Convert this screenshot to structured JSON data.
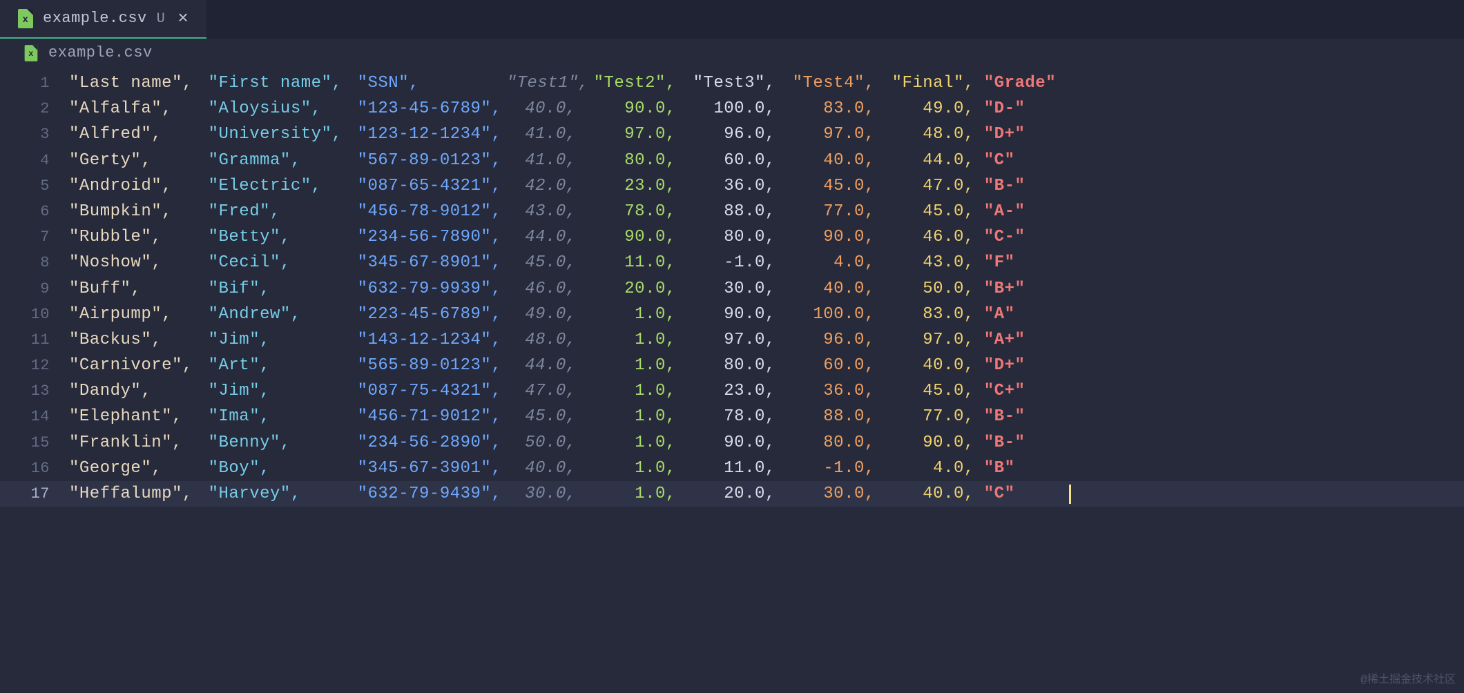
{
  "tab": {
    "filename": "example.csv",
    "modified_indicator": "U",
    "close_glyph": "×"
  },
  "breadcrumb": {
    "filename": "example.csv"
  },
  "watermark": "@稀土掘金技术社区",
  "col_widths_ch": [
    14,
    15,
    15,
    8,
    10,
    10,
    10,
    10,
    9
  ],
  "right_align_cols": [
    3,
    4,
    5,
    6,
    7
  ],
  "rows": [
    {
      "n": 1,
      "cursor": false,
      "cells": [
        {
          "txt": "\"Last name\",",
          "cls": "t-tan"
        },
        {
          "txt": "\"First name\",",
          "cls": "t-cyan"
        },
        {
          "txt": "\"SSN\",",
          "cls": "t-blue"
        },
        {
          "txt": "\"Test1\",",
          "cls": "t-dim"
        },
        {
          "txt": "\"Test2\",",
          "cls": "t-green"
        },
        {
          "txt": "\"Test3\",",
          "cls": "t-white"
        },
        {
          "txt": "\"Test4\",",
          "cls": "t-orange"
        },
        {
          "txt": "\"Final\",",
          "cls": "t-yellow"
        },
        {
          "txt": "\"Grade\"",
          "cls": "t-red"
        }
      ]
    },
    {
      "n": 2,
      "cursor": false,
      "cells": [
        {
          "txt": "\"Alfalfa\",",
          "cls": "t-tan"
        },
        {
          "txt": "\"Aloysius\",",
          "cls": "t-cyan"
        },
        {
          "txt": "\"123-45-6789\",",
          "cls": "t-blue"
        },
        {
          "txt": "40.0,",
          "cls": "t-dim"
        },
        {
          "txt": "90.0,",
          "cls": "t-green"
        },
        {
          "txt": "100.0,",
          "cls": "t-white"
        },
        {
          "txt": "83.0,",
          "cls": "t-orange"
        },
        {
          "txt": "49.0,",
          "cls": "t-yellow"
        },
        {
          "txt": "\"D-\"",
          "cls": "t-red"
        }
      ]
    },
    {
      "n": 3,
      "cursor": false,
      "cells": [
        {
          "txt": "\"Alfred\",",
          "cls": "t-tan"
        },
        {
          "txt": "\"University\",",
          "cls": "t-cyan"
        },
        {
          "txt": "\"123-12-1234\",",
          "cls": "t-blue"
        },
        {
          "txt": "41.0,",
          "cls": "t-dim"
        },
        {
          "txt": "97.0,",
          "cls": "t-green"
        },
        {
          "txt": "96.0,",
          "cls": "t-white"
        },
        {
          "txt": "97.0,",
          "cls": "t-orange"
        },
        {
          "txt": "48.0,",
          "cls": "t-yellow"
        },
        {
          "txt": "\"D+\"",
          "cls": "t-red"
        }
      ]
    },
    {
      "n": 4,
      "cursor": false,
      "cells": [
        {
          "txt": "\"Gerty\",",
          "cls": "t-tan"
        },
        {
          "txt": "\"Gramma\",",
          "cls": "t-cyan"
        },
        {
          "txt": "\"567-89-0123\",",
          "cls": "t-blue"
        },
        {
          "txt": "41.0,",
          "cls": "t-dim"
        },
        {
          "txt": "80.0,",
          "cls": "t-green"
        },
        {
          "txt": "60.0,",
          "cls": "t-white"
        },
        {
          "txt": "40.0,",
          "cls": "t-orange"
        },
        {
          "txt": "44.0,",
          "cls": "t-yellow"
        },
        {
          "txt": "\"C\"",
          "cls": "t-red"
        }
      ]
    },
    {
      "n": 5,
      "cursor": false,
      "cells": [
        {
          "txt": "\"Android\",",
          "cls": "t-tan"
        },
        {
          "txt": "\"Electric\",",
          "cls": "t-cyan"
        },
        {
          "txt": "\"087-65-4321\",",
          "cls": "t-blue"
        },
        {
          "txt": "42.0,",
          "cls": "t-dim"
        },
        {
          "txt": "23.0,",
          "cls": "t-green"
        },
        {
          "txt": "36.0,",
          "cls": "t-white"
        },
        {
          "txt": "45.0,",
          "cls": "t-orange"
        },
        {
          "txt": "47.0,",
          "cls": "t-yellow"
        },
        {
          "txt": "\"B-\"",
          "cls": "t-red"
        }
      ]
    },
    {
      "n": 6,
      "cursor": false,
      "cells": [
        {
          "txt": "\"Bumpkin\",",
          "cls": "t-tan"
        },
        {
          "txt": "\"Fred\",",
          "cls": "t-cyan"
        },
        {
          "txt": "\"456-78-9012\",",
          "cls": "t-blue"
        },
        {
          "txt": "43.0,",
          "cls": "t-dim"
        },
        {
          "txt": "78.0,",
          "cls": "t-green"
        },
        {
          "txt": "88.0,",
          "cls": "t-white"
        },
        {
          "txt": "77.0,",
          "cls": "t-orange"
        },
        {
          "txt": "45.0,",
          "cls": "t-yellow"
        },
        {
          "txt": "\"A-\"",
          "cls": "t-red"
        }
      ]
    },
    {
      "n": 7,
      "cursor": false,
      "cells": [
        {
          "txt": "\"Rubble\",",
          "cls": "t-tan"
        },
        {
          "txt": "\"Betty\",",
          "cls": "t-cyan"
        },
        {
          "txt": "\"234-56-7890\",",
          "cls": "t-blue"
        },
        {
          "txt": "44.0,",
          "cls": "t-dim"
        },
        {
          "txt": "90.0,",
          "cls": "t-green"
        },
        {
          "txt": "80.0,",
          "cls": "t-white"
        },
        {
          "txt": "90.0,",
          "cls": "t-orange"
        },
        {
          "txt": "46.0,",
          "cls": "t-yellow"
        },
        {
          "txt": "\"C-\"",
          "cls": "t-red"
        }
      ]
    },
    {
      "n": 8,
      "cursor": false,
      "cells": [
        {
          "txt": "\"Noshow\",",
          "cls": "t-tan"
        },
        {
          "txt": "\"Cecil\",",
          "cls": "t-cyan"
        },
        {
          "txt": "\"345-67-8901\",",
          "cls": "t-blue"
        },
        {
          "txt": "45.0,",
          "cls": "t-dim"
        },
        {
          "txt": "11.0,",
          "cls": "t-green"
        },
        {
          "txt": "-1.0,",
          "cls": "t-white"
        },
        {
          "txt": "4.0,",
          "cls": "t-orange"
        },
        {
          "txt": "43.0,",
          "cls": "t-yellow"
        },
        {
          "txt": "\"F\"",
          "cls": "t-red"
        }
      ]
    },
    {
      "n": 9,
      "cursor": false,
      "cells": [
        {
          "txt": "\"Buff\",",
          "cls": "t-tan"
        },
        {
          "txt": "\"Bif\",",
          "cls": "t-cyan"
        },
        {
          "txt": "\"632-79-9939\",",
          "cls": "t-blue"
        },
        {
          "txt": "46.0,",
          "cls": "t-dim"
        },
        {
          "txt": "20.0,",
          "cls": "t-green"
        },
        {
          "txt": "30.0,",
          "cls": "t-white"
        },
        {
          "txt": "40.0,",
          "cls": "t-orange"
        },
        {
          "txt": "50.0,",
          "cls": "t-yellow"
        },
        {
          "txt": "\"B+\"",
          "cls": "t-red"
        }
      ]
    },
    {
      "n": 10,
      "cursor": false,
      "cells": [
        {
          "txt": "\"Airpump\",",
          "cls": "t-tan"
        },
        {
          "txt": "\"Andrew\",",
          "cls": "t-cyan"
        },
        {
          "txt": "\"223-45-6789\",",
          "cls": "t-blue"
        },
        {
          "txt": "49.0,",
          "cls": "t-dim"
        },
        {
          "txt": "1.0,",
          "cls": "t-green"
        },
        {
          "txt": "90.0,",
          "cls": "t-white"
        },
        {
          "txt": "100.0,",
          "cls": "t-orange"
        },
        {
          "txt": "83.0,",
          "cls": "t-yellow"
        },
        {
          "txt": "\"A\"",
          "cls": "t-red"
        }
      ]
    },
    {
      "n": 11,
      "cursor": false,
      "cells": [
        {
          "txt": "\"Backus\",",
          "cls": "t-tan"
        },
        {
          "txt": "\"Jim\",",
          "cls": "t-cyan"
        },
        {
          "txt": "\"143-12-1234\",",
          "cls": "t-blue"
        },
        {
          "txt": "48.0,",
          "cls": "t-dim"
        },
        {
          "txt": "1.0,",
          "cls": "t-green"
        },
        {
          "txt": "97.0,",
          "cls": "t-white"
        },
        {
          "txt": "96.0,",
          "cls": "t-orange"
        },
        {
          "txt": "97.0,",
          "cls": "t-yellow"
        },
        {
          "txt": "\"A+\"",
          "cls": "t-red"
        }
      ]
    },
    {
      "n": 12,
      "cursor": false,
      "cells": [
        {
          "txt": "\"Carnivore\",",
          "cls": "t-tan"
        },
        {
          "txt": "\"Art\",",
          "cls": "t-cyan"
        },
        {
          "txt": "\"565-89-0123\",",
          "cls": "t-blue"
        },
        {
          "txt": "44.0,",
          "cls": "t-dim"
        },
        {
          "txt": "1.0,",
          "cls": "t-green"
        },
        {
          "txt": "80.0,",
          "cls": "t-white"
        },
        {
          "txt": "60.0,",
          "cls": "t-orange"
        },
        {
          "txt": "40.0,",
          "cls": "t-yellow"
        },
        {
          "txt": "\"D+\"",
          "cls": "t-red"
        }
      ]
    },
    {
      "n": 13,
      "cursor": false,
      "cells": [
        {
          "txt": "\"Dandy\",",
          "cls": "t-tan"
        },
        {
          "txt": "\"Jim\",",
          "cls": "t-cyan"
        },
        {
          "txt": "\"087-75-4321\",",
          "cls": "t-blue"
        },
        {
          "txt": "47.0,",
          "cls": "t-dim"
        },
        {
          "txt": "1.0,",
          "cls": "t-green"
        },
        {
          "txt": "23.0,",
          "cls": "t-white"
        },
        {
          "txt": "36.0,",
          "cls": "t-orange"
        },
        {
          "txt": "45.0,",
          "cls": "t-yellow"
        },
        {
          "txt": "\"C+\"",
          "cls": "t-red"
        }
      ]
    },
    {
      "n": 14,
      "cursor": false,
      "cells": [
        {
          "txt": "\"Elephant\",",
          "cls": "t-tan"
        },
        {
          "txt": "\"Ima\",",
          "cls": "t-cyan"
        },
        {
          "txt": "\"456-71-9012\",",
          "cls": "t-blue"
        },
        {
          "txt": "45.0,",
          "cls": "t-dim"
        },
        {
          "txt": "1.0,",
          "cls": "t-green"
        },
        {
          "txt": "78.0,",
          "cls": "t-white"
        },
        {
          "txt": "88.0,",
          "cls": "t-orange"
        },
        {
          "txt": "77.0,",
          "cls": "t-yellow"
        },
        {
          "txt": "\"B-\"",
          "cls": "t-red"
        }
      ]
    },
    {
      "n": 15,
      "cursor": false,
      "cells": [
        {
          "txt": "\"Franklin\",",
          "cls": "t-tan"
        },
        {
          "txt": "\"Benny\",",
          "cls": "t-cyan"
        },
        {
          "txt": "\"234-56-2890\",",
          "cls": "t-blue"
        },
        {
          "txt": "50.0,",
          "cls": "t-dim"
        },
        {
          "txt": "1.0,",
          "cls": "t-green"
        },
        {
          "txt": "90.0,",
          "cls": "t-white"
        },
        {
          "txt": "80.0,",
          "cls": "t-orange"
        },
        {
          "txt": "90.0,",
          "cls": "t-yellow"
        },
        {
          "txt": "\"B-\"",
          "cls": "t-red"
        }
      ]
    },
    {
      "n": 16,
      "cursor": false,
      "cells": [
        {
          "txt": "\"George\",",
          "cls": "t-tan"
        },
        {
          "txt": "\"Boy\",",
          "cls": "t-cyan"
        },
        {
          "txt": "\"345-67-3901\",",
          "cls": "t-blue"
        },
        {
          "txt": "40.0,",
          "cls": "t-dim"
        },
        {
          "txt": "1.0,",
          "cls": "t-green"
        },
        {
          "txt": "11.0,",
          "cls": "t-white"
        },
        {
          "txt": "-1.0,",
          "cls": "t-orange"
        },
        {
          "txt": "4.0,",
          "cls": "t-yellow"
        },
        {
          "txt": "\"B\"",
          "cls": "t-red"
        }
      ]
    },
    {
      "n": 17,
      "cursor": true,
      "cells": [
        {
          "txt": "\"Heffalump\",",
          "cls": "t-tan"
        },
        {
          "txt": "\"Harvey\",",
          "cls": "t-cyan"
        },
        {
          "txt": "\"632-79-9439\",",
          "cls": "t-blue"
        },
        {
          "txt": "30.0,",
          "cls": "t-dim"
        },
        {
          "txt": "1.0,",
          "cls": "t-green"
        },
        {
          "txt": "20.0,",
          "cls": "t-white"
        },
        {
          "txt": "30.0,",
          "cls": "t-orange"
        },
        {
          "txt": "40.0,",
          "cls": "t-yellow"
        },
        {
          "txt": "\"C\"",
          "cls": "t-red",
          "caret": true
        }
      ]
    }
  ]
}
